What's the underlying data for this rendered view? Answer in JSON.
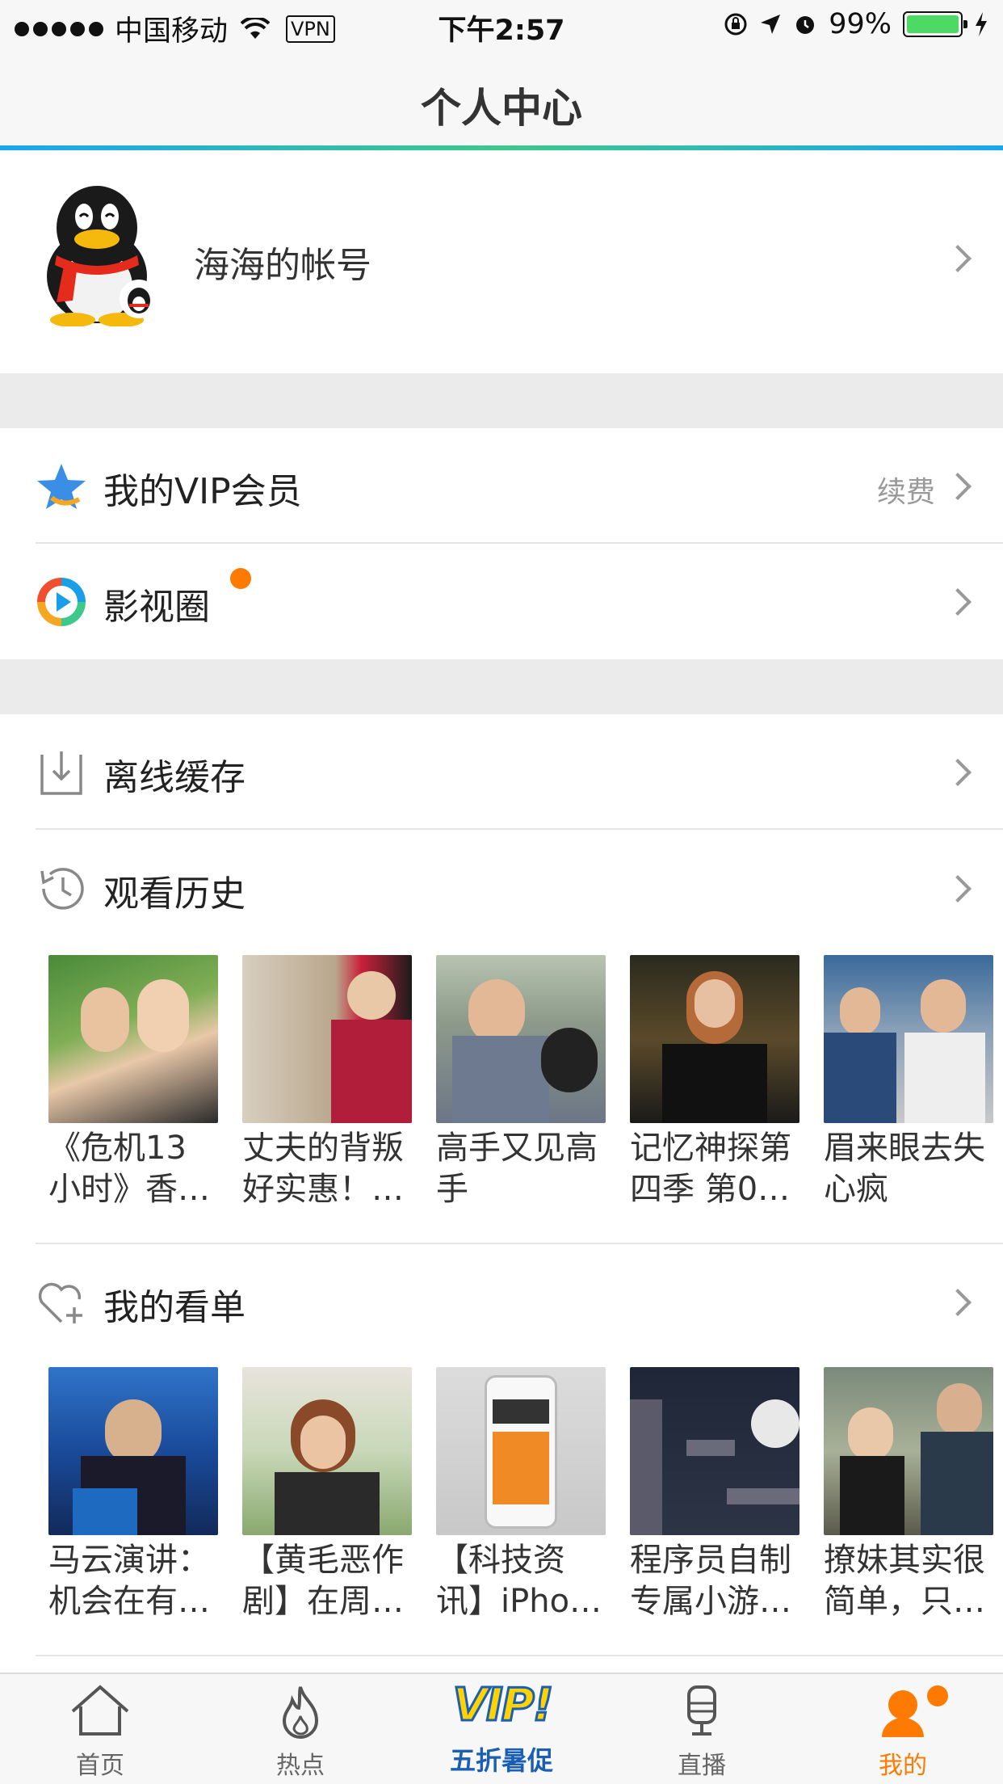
{
  "status_bar": {
    "carrier": "中国移动",
    "vpn": "VPN",
    "time": "下午2:57",
    "battery": "99%"
  },
  "nav": {
    "title": "个人中心"
  },
  "profile": {
    "name": "海海的帐号"
  },
  "menu": {
    "vip": {
      "label": "我的VIP会员",
      "trailing": "续费"
    },
    "circle": {
      "label": "影视圈"
    },
    "offline": {
      "label": "离线缓存"
    },
    "history": {
      "label": "观看历史",
      "items": [
        {
          "title": "《危机13小时》香…"
        },
        {
          "title": "丈夫的背叛好实惠！…"
        },
        {
          "title": "高手又见高手"
        },
        {
          "title": "记忆神探第四季 第0…"
        },
        {
          "title": "眉来眼去失心疯"
        }
      ]
    },
    "watchlist": {
      "label": "我的看单",
      "items": [
        {
          "title": "马云演讲：机会在有…"
        },
        {
          "title": "【黄毛恶作剧】在周…"
        },
        {
          "title": "【科技资讯】iPho…"
        },
        {
          "title": "程序员自制专属小游…"
        },
        {
          "title": "撩妹其实很简单，只…"
        }
      ]
    }
  },
  "tabs": [
    {
      "label": "首页"
    },
    {
      "label": "热点"
    },
    {
      "label": "五折暑促",
      "badge": "VIP!"
    },
    {
      "label": "直播"
    },
    {
      "label": "我的"
    }
  ],
  "colors": {
    "accent": "#ff7a00",
    "nav_line": "#19a6f0",
    "battery": "#4cd964"
  }
}
